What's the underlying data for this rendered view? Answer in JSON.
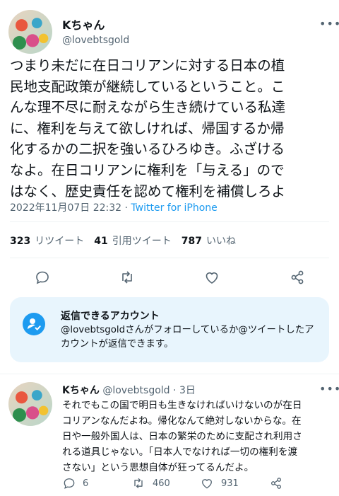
{
  "tweet": {
    "display_name": "Kちゃん",
    "handle": "@lovebtsgold",
    "text": "つまり未だに在日コリアンに対する日本の植\n民地支配政策が継続しているということ。こ\nんな理不尽に耐えながら生き続けている私達\nに、権利を与えて欲しければ、帰国するか帰\n化するかの二択を強いるひろゆき。ふざける\nなよ。在日コリアンに権利を「与える」ので\nはなく、歴史責任を認めて権利を補償しろよ",
    "timestamp": "2022年11月07日 22:32",
    "separator": " · ",
    "source": "Twitter for iPhone",
    "stats": {
      "retweets": "323",
      "retweets_label": "リツイート",
      "quotes": "41",
      "quotes_label": "引用ツイート",
      "likes": "787",
      "likes_label": "いいね"
    }
  },
  "reply_settings": {
    "title": "返信できるアカウント",
    "description": "@lovebtsgoldさんがフォローしているか@ツイートしたアカウントが返信できます。"
  },
  "reply": {
    "display_name": "Kちゃん",
    "handle": "@lovebtsgold",
    "separator": " · ",
    "age": "3日",
    "text": "それでもこの国で明日も生きなければいけないのが在日\nコリアンなんだよね。帰化なんて絶対しないからな。在\n日や一般外国人は、日本の繁栄のために支配され利用さ\nれる道具じゃない。「日本人でなければ一切の権利を渡\nさない」という思想自体が狂ってるんだよ。",
    "reply_count": "6",
    "retweet_count": "460",
    "like_count": "931"
  },
  "icons": [
    "avatar",
    "more-icon",
    "reply-icon",
    "retweet-icon",
    "like-icon",
    "share-icon",
    "person-check-icon"
  ]
}
